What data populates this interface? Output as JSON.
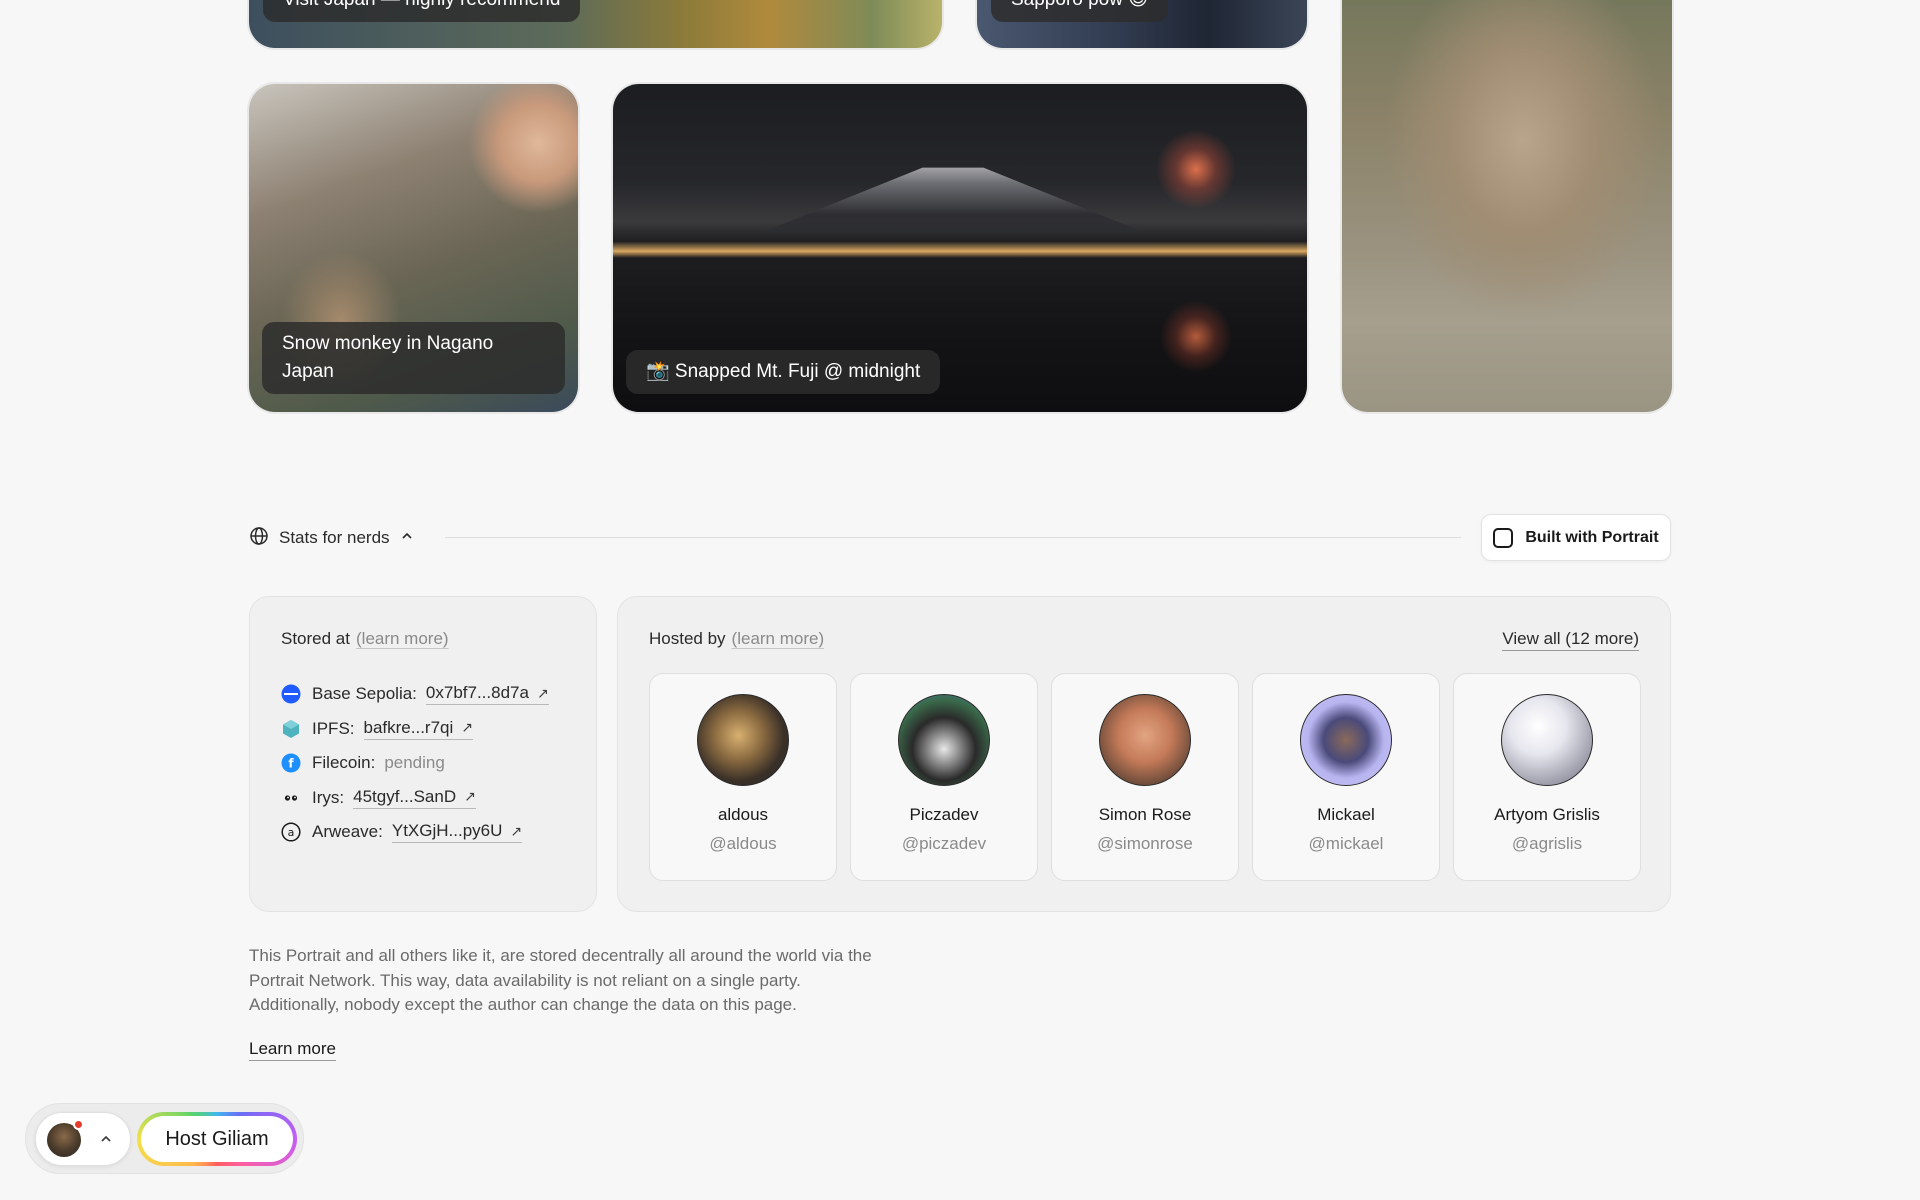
{
  "gallery": {
    "captions": {
      "japan": "Visit Japan — highly recommend",
      "sapporo": "Sapporo pow 😍",
      "nagano": "Snow monkey in Nagano Japan",
      "fuji": "📸 Snapped Mt. Fuji @ midnight"
    }
  },
  "stats": {
    "toggle_label": "Stats for nerds",
    "built_with_label": "Built with Portrait"
  },
  "stored": {
    "title": "Stored at",
    "learn_more": "(learn more)",
    "items": [
      {
        "icon": "base-icon",
        "label": "Base Sepolia:",
        "value": "0x7bf7...8d7a",
        "color": "#1f5bff"
      },
      {
        "icon": "ipfs-icon",
        "label": "IPFS:",
        "value": "bafkre...r7qi",
        "color": "#4fb3bf"
      },
      {
        "icon": "filecoin-icon",
        "label": "Filecoin:",
        "value": "pending",
        "color": "#1e8fff"
      },
      {
        "icon": "irys-icon",
        "label": "Irys:",
        "value": "45tgyf...SanD",
        "color": "#1a1a1a"
      },
      {
        "icon": "arweave-icon",
        "label": "Arweave:",
        "value": "YtXGjH...py6U",
        "color": "#1a1a1a"
      }
    ]
  },
  "hosted": {
    "title": "Hosted by",
    "learn_more": "(learn more)",
    "view_all": "View all (12 more)",
    "hosts": [
      {
        "name": "aldous",
        "handle": "@aldous"
      },
      {
        "name": "Piczadev",
        "handle": "@piczadev"
      },
      {
        "name": "Simon Rose",
        "handle": "@simonrose"
      },
      {
        "name": "Mickael",
        "handle": "@mickael"
      },
      {
        "name": "Artyom Grislis",
        "handle": "@agrislis"
      }
    ]
  },
  "footer": {
    "about": "This Portrait and all others like it, are stored decentrally all around the world via the Portrait Network. This way, data availability is not reliant on a single party. Additionally, nobody except the author can change the data on this page.",
    "learn_more": "Learn more"
  },
  "floating_bar": {
    "host_button": "Host Giliam"
  },
  "colors": {
    "background": "#f7f7f7",
    "notification": "#e53b2f"
  }
}
